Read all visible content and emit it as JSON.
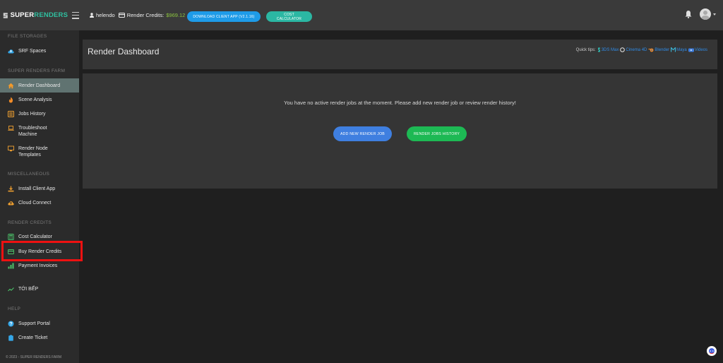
{
  "brand": {
    "name_part1": "SUPER",
    "name_part2": "RENDERS"
  },
  "topbar": {
    "username": "helendo",
    "credits_label": "Render Credits:",
    "credits_value": "$969.12",
    "download_button": "DOWNLOAD CLIENT APP (V2.1.16)",
    "cost_button": "COST CALCULATOR"
  },
  "sidebar": {
    "sections": {
      "file_storages": "FILE STORAGES",
      "farm": "SUPER RENDERS FARM",
      "misc": "MISCELLANEOUS",
      "credits": "RENDER CREDITS",
      "help": "HELP"
    },
    "items": {
      "srf_spaces": "SRF Spaces",
      "render_dashboard": "Render Dashboard",
      "scene_analysis": "Scene Analysis",
      "jobs_history": "Jobs History",
      "troubleshoot_1": "Troubleshoot",
      "troubleshoot_2": "Machine",
      "render_node_1": "Render Node",
      "render_node_2": "Templates",
      "install_client": "Install Client App",
      "cloud_connect": "Cloud Connect",
      "cost_calculator": "Cost Calculator",
      "buy_credits": "Buy Render Credits",
      "payment_invoices": "Payment Invoices",
      "toi_bep": "TỚI BẾP",
      "support_portal": "Support Portal",
      "create_ticket": "Create Ticket"
    },
    "copyright": "© 2023 - SUPER RENDERS FARM"
  },
  "main": {
    "title": "Render Dashboard",
    "quick_tips_label": "Quick tips:",
    "tips": [
      "3DS Max",
      "Cinema 4D",
      "Blender",
      "Maya",
      "Videos"
    ],
    "empty_message": "You have no active render jobs at the moment. Please add new render job or review render history!",
    "add_button": "ADD NEW RENDER JOB",
    "history_button": "RENDER JOBS HISTORY"
  },
  "colors": {
    "accent_teal": "#2bb7a3",
    "accent_blue": "#1e9be8",
    "credits_green": "#8dc63f",
    "active_item": "#607371",
    "highlight_red": "#ee1111"
  }
}
